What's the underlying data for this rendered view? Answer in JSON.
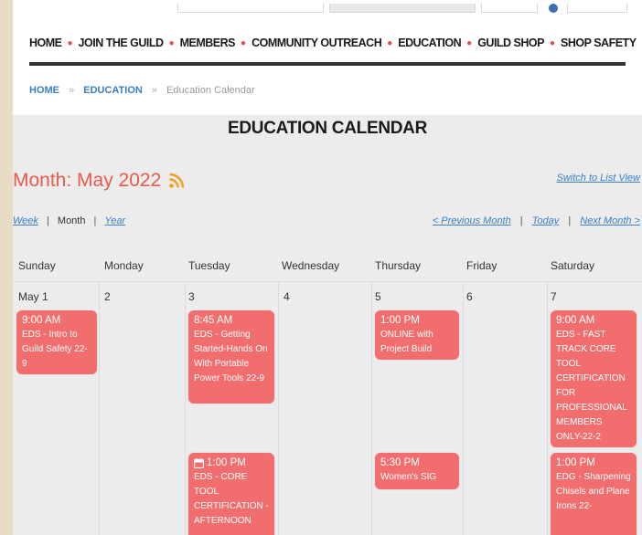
{
  "nav": {
    "items": [
      "HOME",
      "JOIN THE GUILD",
      "MEMBERS",
      "COMMUNITY OUTREACH",
      "EDUCATION",
      "GUILD SHOP",
      "SHOP SAFETY"
    ]
  },
  "breadcrumb": {
    "home": "HOME",
    "education": "EDUCATION",
    "current": "Education Calendar",
    "separator": "»"
  },
  "page_title": "EDUCATION CALENDAR",
  "month_heading": "Month: May 2022",
  "switch_view": "Switch to List View",
  "views": {
    "week": "Week",
    "month": "Month",
    "year": "Year",
    "separator": "|"
  },
  "month_nav": {
    "previous": "< Previous Month",
    "today": "Today",
    "next": "Next Month >",
    "separator": "|"
  },
  "weekdays": [
    "Sunday",
    "Monday",
    "Tuesday",
    "Wednesday",
    "Thursday",
    "Friday",
    "Saturday"
  ],
  "days": [
    "May 1",
    "2",
    "3",
    "4",
    "5",
    "6",
    "7"
  ],
  "events": [
    {
      "time": "9:00 AM",
      "title": "EDS - Intro to Guild Safety 22-9"
    },
    {
      "time": "8:45 AM",
      "title": "EDS - Getting Started-Hands On With Portable Power Tools 22-9"
    },
    {
      "time": "1:00 PM",
      "title": "ONLINE with Project Build"
    },
    {
      "time": "9:00 AM",
      "title": "EDS - FAST TRACK CORE TOOL CERTIFICATION FOR PROFESSIONAL MEMBERS ONLY-22-2"
    },
    {
      "time": "1:00 PM",
      "title": "EDS - CORE TOOL CERTIFICATION - AFTERNOON"
    },
    {
      "time": "5:30 PM",
      "title": "Women's SIG"
    },
    {
      "time": "1:00 PM",
      "title": "EDG - Sharpening Chisels and Plane Irons 22-"
    }
  ],
  "colors": {
    "accent": "#e85a4a",
    "event_bg": "#f26e6e",
    "link": "#3a7fc8",
    "rss": "#f0a020"
  },
  "icons": {
    "rss": "rss-icon",
    "calendar": "calendar-icon"
  }
}
